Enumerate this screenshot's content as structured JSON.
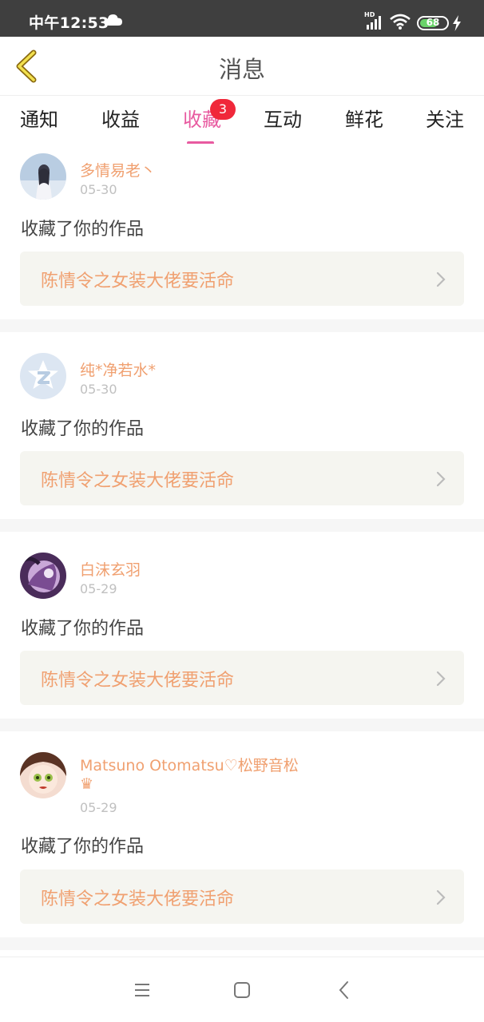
{
  "status_bar": {
    "time": "中午12:53",
    "hd": "HD",
    "battery": "68"
  },
  "header": {
    "title": "消息"
  },
  "tabs": [
    {
      "label": "通知",
      "active": false
    },
    {
      "label": "收益",
      "active": false
    },
    {
      "label": "收藏",
      "active": true,
      "badge": "3"
    },
    {
      "label": "互动",
      "active": false
    },
    {
      "label": "鲜花",
      "active": false
    },
    {
      "label": "关注",
      "active": false
    }
  ],
  "notifications": [
    {
      "username": "多情易老丶",
      "date": "05-30",
      "action": "收藏了你的作品",
      "work_title": "陈情令之女装大佬要活命"
    },
    {
      "username": "纯*净若水*",
      "date": "05-30",
      "action": "收藏了你的作品",
      "work_title": "陈情令之女装大佬要活命"
    },
    {
      "username": "白沫玄羽",
      "date": "05-29",
      "action": "收藏了你的作品",
      "work_title": "陈情令之女装大佬要活命"
    },
    {
      "username": "Matsuno Otomatsu♡松野音松",
      "crown": "♛",
      "date": "05-29",
      "action": "收藏了你的作品",
      "work_title": "陈情令之女装大佬要活命"
    }
  ],
  "colors": {
    "accent": "#e85aa0",
    "username": "#f0a070",
    "badge": "#f0283a"
  }
}
